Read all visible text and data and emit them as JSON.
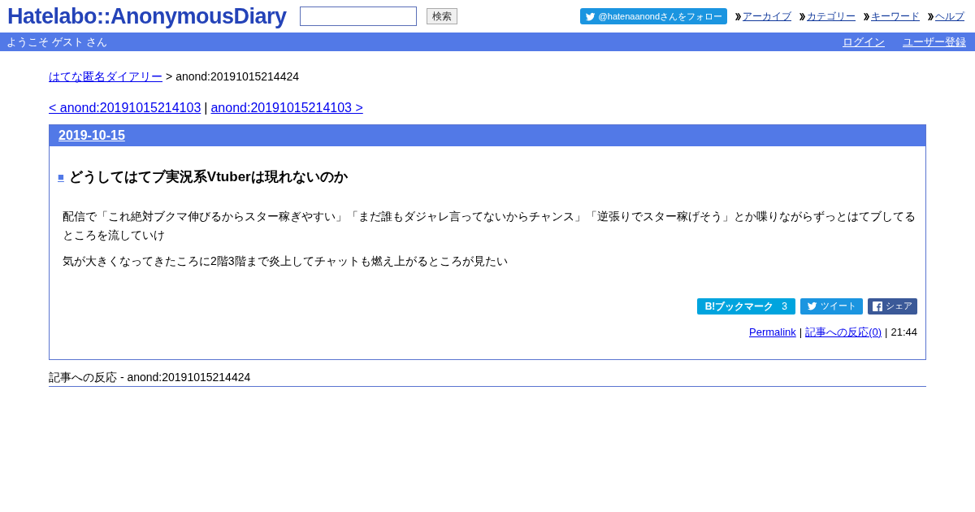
{
  "header": {
    "logo": "Hatelabo::AnonymousDiary",
    "search": {
      "button": "検索"
    },
    "follow_button": "@hatenaanondさんをフォロー",
    "nav_links": [
      "アーカイブ",
      "カテゴリー",
      "キーワード",
      "ヘルプ"
    ]
  },
  "user_bar": {
    "welcome": "ようこそ ゲスト さん",
    "links": [
      "ログイン",
      "ユーザー登録"
    ]
  },
  "breadcrumb": {
    "home": "はてな匿名ダイアリー",
    "separator": ">",
    "current": "anond:20191015214424"
  },
  "pager": {
    "prev": "< anond:20191015214103",
    "separator": "|",
    "next": "anond:20191015214103 >"
  },
  "entry": {
    "date": "2019-10-15",
    "marker": "■",
    "title": "どうしてはてブ実況系Vtuberは現れないのか",
    "paragraphs": [
      "配信で「これ絶対ブクマ伸びるからスター稼ぎやすい」「まだ誰もダジャレ言ってないからチャンス」「逆張りでスター稼げそう」とか喋りながらずっとはてブしてるところを流していけ",
      "気が大きくなってきたころに2階3階まで炎上してチャットも燃え上がるところが見たい"
    ],
    "share": {
      "bookmark_logo": "B!",
      "bookmark_label": "ブックマーク",
      "bookmark_count": "3",
      "tweet": "ツイート",
      "share": "シェア"
    },
    "footer": {
      "permalink": "Permalink",
      "sep1": "|",
      "reactions": "記事への反応(0)",
      "sep2": "|",
      "time": "21:44"
    }
  },
  "reactions_heading": "記事への反応 - anond:20191015214424"
}
